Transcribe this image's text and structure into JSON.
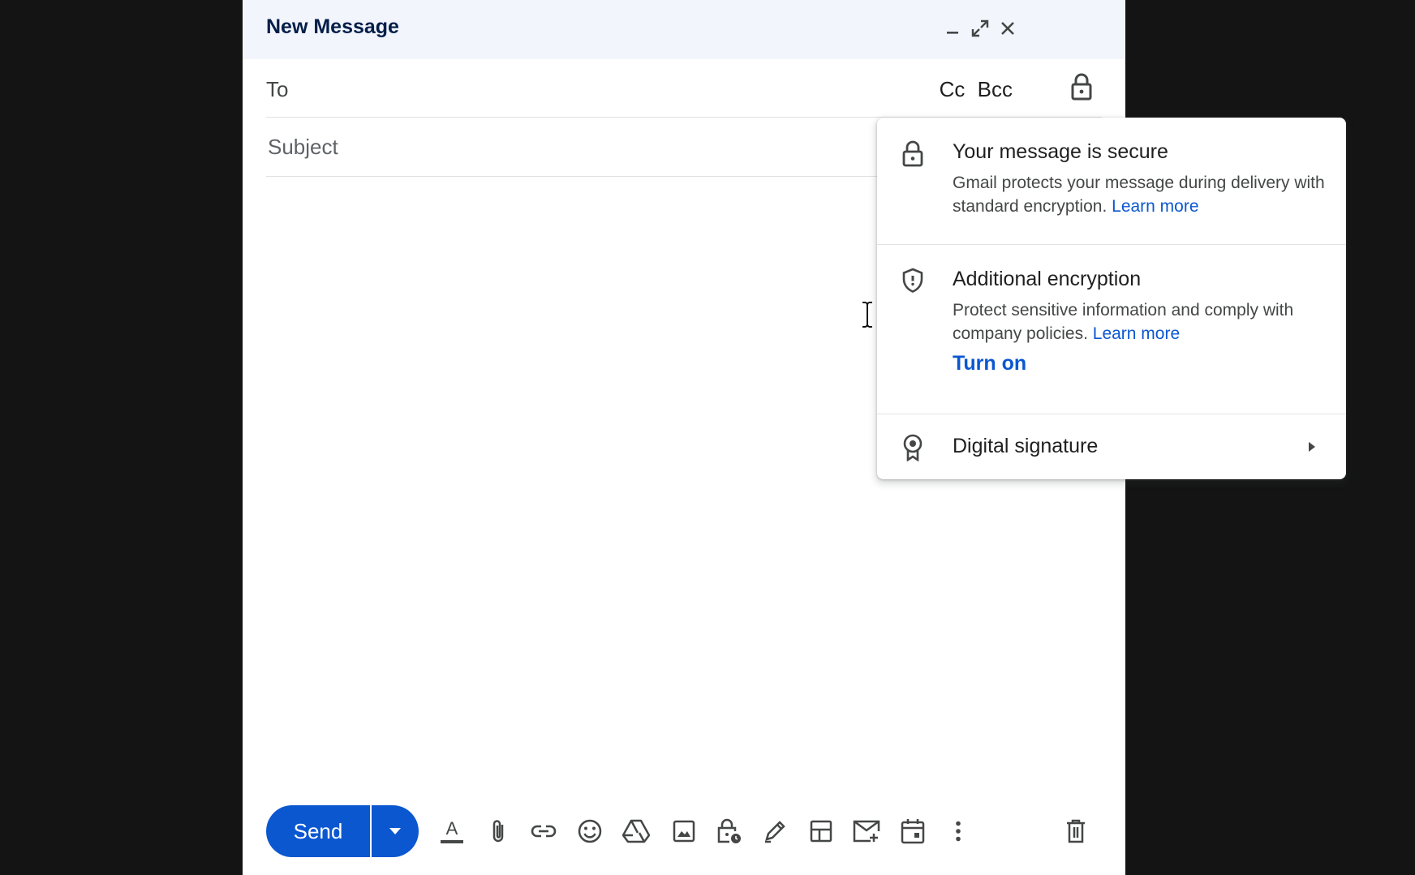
{
  "window": {
    "title": "New Message",
    "background": "#141414",
    "titlebar_color": "#f2f6fc"
  },
  "recipients": {
    "to_label": "To",
    "to_value": "",
    "cc_label": "Cc",
    "bcc_label": "Bcc"
  },
  "subject": {
    "placeholder": "Subject",
    "value": ""
  },
  "security_popup": {
    "secure": {
      "title": "Your message is secure",
      "body": "Gmail protects your message during delivery with standard encryption.",
      "link": "Learn more"
    },
    "encryption": {
      "title": "Additional encryption",
      "body": "Protect sensitive information and comply with company policies.",
      "link": "Learn more",
      "action": "Turn on"
    },
    "signature": {
      "label": "Digital signature"
    }
  },
  "toolbar": {
    "send_label": "Send",
    "accent": "#0b57d0",
    "icons": [
      "formatting-options-icon",
      "attach-file-icon",
      "insert-link-icon",
      "insert-emoji-icon",
      "google-drive-icon",
      "insert-photo-icon",
      "confidential-mode-icon",
      "insert-signature-icon",
      "layouts-icon",
      "email-template-icon",
      "schedule-event-icon",
      "more-options-icon",
      "discard-draft-icon"
    ]
  }
}
